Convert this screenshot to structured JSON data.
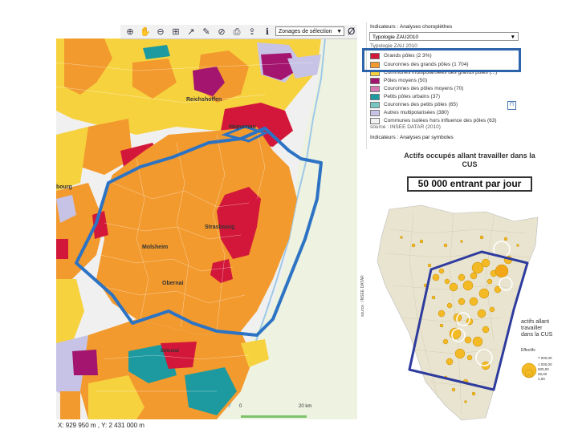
{
  "toolbar": {
    "icons": [
      "zoom-in-icon",
      "pan-hand-icon",
      "zoom-out-icon",
      "zoom-box-icon",
      "identify-icon",
      "ruler-icon",
      "measure-area-icon",
      "print-icon",
      "export-icon",
      "info-icon",
      "selection-icon"
    ],
    "select_value": "Zonages de sélection",
    "clear_glyph": "Ø"
  },
  "map": {
    "place_labels": [
      {
        "name": "Reichshoffen"
      },
      {
        "name": "Haguenau"
      },
      {
        "name": "bourg"
      },
      {
        "name": "Strasbourg"
      },
      {
        "name": "Molsheim"
      },
      {
        "name": "Obernai"
      },
      {
        "name": "Sélestat"
      }
    ],
    "coords": "X: 929 950 m , Y: 2 431 000 m",
    "scale_left": "0",
    "scale_right": "20 km",
    "credit": "source : INSEE DATAR",
    "colors": {
      "grands_poles": "#f29a2e",
      "couronne": "#f7d23f",
      "red": "#d3173a",
      "magenta": "#a3156e",
      "teal": "#1c9aa0",
      "lavender": "#c7c3e6",
      "grey": "#f0f0f0",
      "boundary": "#2d73c4"
    }
  },
  "legend": {
    "indicator_label": "Indicateurs : Analyses choroplèthes",
    "select_value": "Typologie ZAU2010",
    "subtitle": "Typologie ZAU 2010",
    "items": [
      {
        "label": "Grands pôles (2 3%)",
        "color": "#d3173a"
      },
      {
        "label": "Couronnes des grands pôles (1 704)",
        "color": "#f29a2e"
      },
      {
        "label": "Communes multipolarisées des grands pôles (...)",
        "color": "#f7d23f"
      },
      {
        "label": "Pôles moyens (50)",
        "color": "#a3156e"
      },
      {
        "label": "Couronnes des pôles moyens (70)",
        "color": "#d779b2"
      },
      {
        "label": "Petits pôles urbains (37)",
        "color": "#1c9aa0"
      },
      {
        "label": "Couronnes des petits pôles (65)",
        "color": "#76c7c2"
      },
      {
        "label": "Autres multipolarisées (380)",
        "color": "#c7c3e6"
      },
      {
        "label": "Communes isolées hors influence des pôles (63)",
        "color": "#f2f2f2"
      }
    ],
    "source": "source : INSEE DATAR (2010)",
    "symbols_label": "Indicateurs : Analyses par symboles"
  },
  "inset": {
    "title_line1": "Actifs occupés allant travailler dans la",
    "title_line2": "CUS",
    "highlight_text": "50 000 entrant par jour",
    "legend_title": "actifs allant travailler dans la CUS",
    "legend_unit": "Effectifs",
    "legend_values": [
      "7 000,00",
      "1 000,00",
      "500,00",
      "25,00",
      "1,00"
    ]
  }
}
